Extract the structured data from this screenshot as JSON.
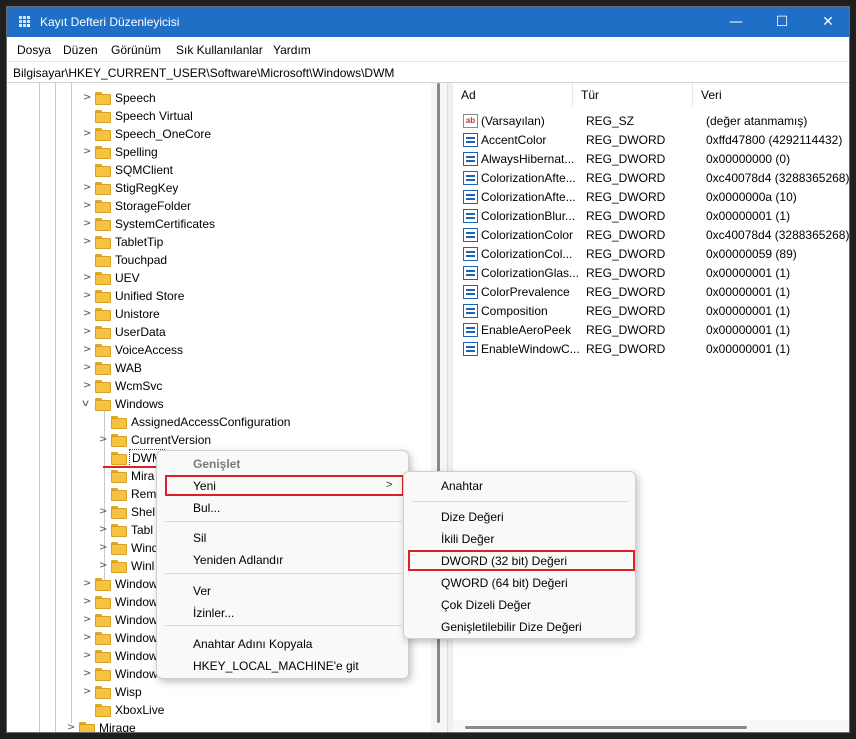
{
  "window": {
    "title": "Kayıt Defteri Düzenleyicisi",
    "minimize_glyph": "—",
    "maximize_glyph": "☐",
    "close_glyph": "✕",
    "accent": "#1f6fc6"
  },
  "menu": [
    "Dosya",
    "Düzen",
    "Görünüm",
    "Sık Kullanılanlar",
    "Yardım"
  ],
  "address": "Bilgisayar\\HKEY_CURRENT_USER\\Software\\Microsoft\\Windows\\DWM",
  "tree": [
    {
      "label": "Speech",
      "chevron": ">"
    },
    {
      "label": "Speech Virtual",
      "chevron": ""
    },
    {
      "label": "Speech_OneCore",
      "chevron": ">"
    },
    {
      "label": "Spelling",
      "chevron": ">"
    },
    {
      "label": "SQMClient",
      "chevron": ""
    },
    {
      "label": "StigRegKey",
      "chevron": ">"
    },
    {
      "label": "StorageFolder",
      "chevron": ">"
    },
    {
      "label": "SystemCertificates",
      "chevron": ">"
    },
    {
      "label": "TabletTip",
      "chevron": ">"
    },
    {
      "label": "Touchpad",
      "chevron": ""
    },
    {
      "label": "UEV",
      "chevron": ">"
    },
    {
      "label": "Unified Store",
      "chevron": ">"
    },
    {
      "label": "Unistore",
      "chevron": ">"
    },
    {
      "label": "UserData",
      "chevron": ">"
    },
    {
      "label": "VoiceAccess",
      "chevron": ">"
    },
    {
      "label": "WAB",
      "chevron": ">"
    },
    {
      "label": "WcmSvc",
      "chevron": ">"
    },
    {
      "label": "Windows",
      "chevron": "v"
    },
    {
      "label": "AssignedAccessConfiguration",
      "chevron": ""
    },
    {
      "label": "CurrentVersion",
      "chevron": ">"
    },
    {
      "label": "DWM",
      "chevron": ""
    },
    {
      "label": "Mira",
      "chevron": ""
    },
    {
      "label": "Rem",
      "chevron": ""
    },
    {
      "label": "Shel",
      "chevron": ">"
    },
    {
      "label": "Tabl",
      "chevron": ">"
    },
    {
      "label": "Wind",
      "chevron": ">"
    },
    {
      "label": "Winl",
      "chevron": ">"
    },
    {
      "label": "Window",
      "chevron": ">"
    },
    {
      "label": "Window",
      "chevron": ">"
    },
    {
      "label": "Window",
      "chevron": ">"
    },
    {
      "label": "Window",
      "chevron": ">"
    },
    {
      "label": "Window",
      "chevron": ">"
    },
    {
      "label": "Window",
      "chevron": ">"
    },
    {
      "label": "Wisp",
      "chevron": ">"
    },
    {
      "label": "XboxLive",
      "chevron": ""
    },
    {
      "label": "Mirage",
      "chevron": ">"
    }
  ],
  "values": {
    "headers": [
      "Ad",
      "Tür",
      "Veri"
    ],
    "rows": [
      {
        "name": "(Varsayılan)",
        "type": "REG_SZ",
        "data": "(değer atanmamış)",
        "icon": "string-value-icon"
      },
      {
        "name": "AccentColor",
        "type": "REG_DWORD",
        "data": "0xffd47800 (4292114432)",
        "icon": "dword-value-icon"
      },
      {
        "name": "AlwaysHibernat...",
        "type": "REG_DWORD",
        "data": "0x00000000 (0)",
        "icon": "dword-value-icon"
      },
      {
        "name": "ColorizationAfte...",
        "type": "REG_DWORD",
        "data": "0xc40078d4 (3288365268)",
        "icon": "dword-value-icon"
      },
      {
        "name": "ColorizationAfte...",
        "type": "REG_DWORD",
        "data": "0x0000000a (10)",
        "icon": "dword-value-icon"
      },
      {
        "name": "ColorizationBlur...",
        "type": "REG_DWORD",
        "data": "0x00000001 (1)",
        "icon": "dword-value-icon"
      },
      {
        "name": "ColorizationColor",
        "type": "REG_DWORD",
        "data": "0xc40078d4 (3288365268)",
        "icon": "dword-value-icon"
      },
      {
        "name": "ColorizationCol...",
        "type": "REG_DWORD",
        "data": "0x00000059 (89)",
        "icon": "dword-value-icon"
      },
      {
        "name": "ColorizationGlas...",
        "type": "REG_DWORD",
        "data": "0x00000001 (1)",
        "icon": "dword-value-icon"
      },
      {
        "name": "ColorPrevalence",
        "type": "REG_DWORD",
        "data": "0x00000001 (1)",
        "icon": "dword-value-icon"
      },
      {
        "name": "Composition",
        "type": "REG_DWORD",
        "data": "0x00000001 (1)",
        "icon": "dword-value-icon"
      },
      {
        "name": "EnableAeroPeek",
        "type": "REG_DWORD",
        "data": "0x00000001 (1)",
        "icon": "dword-value-icon"
      },
      {
        "name": "EnableWindowC...",
        "type": "REG_DWORD",
        "data": "0x00000001 (1)",
        "icon": "dword-value-icon"
      }
    ]
  },
  "context_menu": {
    "items": [
      {
        "label": "Genişlet",
        "disabled": true
      },
      {
        "label": "Yeni",
        "submenu": true
      },
      {
        "label": "Bul..."
      },
      {
        "label": "Sil"
      },
      {
        "label": "Yeniden Adlandır"
      },
      {
        "label": "Ver"
      },
      {
        "label": "İzinler..."
      },
      {
        "label": "Anahtar Adını Kopyala"
      },
      {
        "label": "HKEY_LOCAL_MACHINE'e git"
      }
    ],
    "submenu_arrow": ">"
  },
  "submenu": {
    "items": [
      {
        "label": "Anahtar"
      },
      {
        "label": "Dize Değeri"
      },
      {
        "label": "İkili Değer"
      },
      {
        "label": "DWORD (32 bit) Değeri"
      },
      {
        "label": "QWORD (64 bit) Değeri"
      },
      {
        "label": "Çok Dizeli Değer"
      },
      {
        "label": "Genişletilebilir Dize Değeri"
      }
    ]
  },
  "highlight_color": "#e01e28"
}
